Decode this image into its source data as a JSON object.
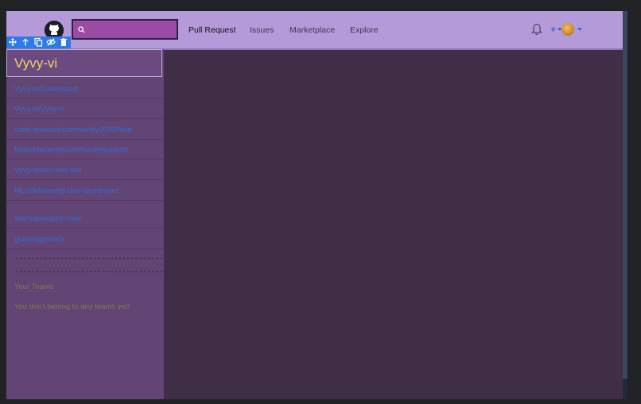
{
  "header": {
    "search_placeholder": "",
    "nav": [
      "Pull Request",
      "Issues",
      "Marketplace",
      "Explore"
    ],
    "plus_label": "+"
  },
  "sidebar": {
    "title": "Vyvy-vi",
    "repos": [
      "Vyvy-vi/Dashboard",
      "Vyvy-vi/Vyvy-vi",
      "code-sponsor/community2020/help",
      "freecodecamp/community/support",
      "Vyvy-vi/dev-tool-site",
      "MLH/fellowship-dev-dashboard",
      "Warrego/liquid-code",
      "guild/logpatrick"
    ],
    "divider1": "--------------------------------------",
    "divider2": "--------------------------------------",
    "teams_heading": "Your Teams",
    "teams_empty": "You don't belong to any teams yet!"
  },
  "colors": {
    "header_bg": "#b59ad9",
    "search_bg": "#9b4ba3",
    "sidebar_bg": "#624475",
    "main_bg": "#3f2e45",
    "title_color": "#f2d36b",
    "link_color": "#2f6fd8",
    "toolbar_bg": "#2e7ae6"
  },
  "icons": [
    "github-logo-icon",
    "search-icon",
    "bell-icon",
    "plus-icon",
    "avatar",
    "move-icon",
    "arrow-up-icon",
    "copy-icon",
    "hide-icon",
    "trash-icon"
  ]
}
